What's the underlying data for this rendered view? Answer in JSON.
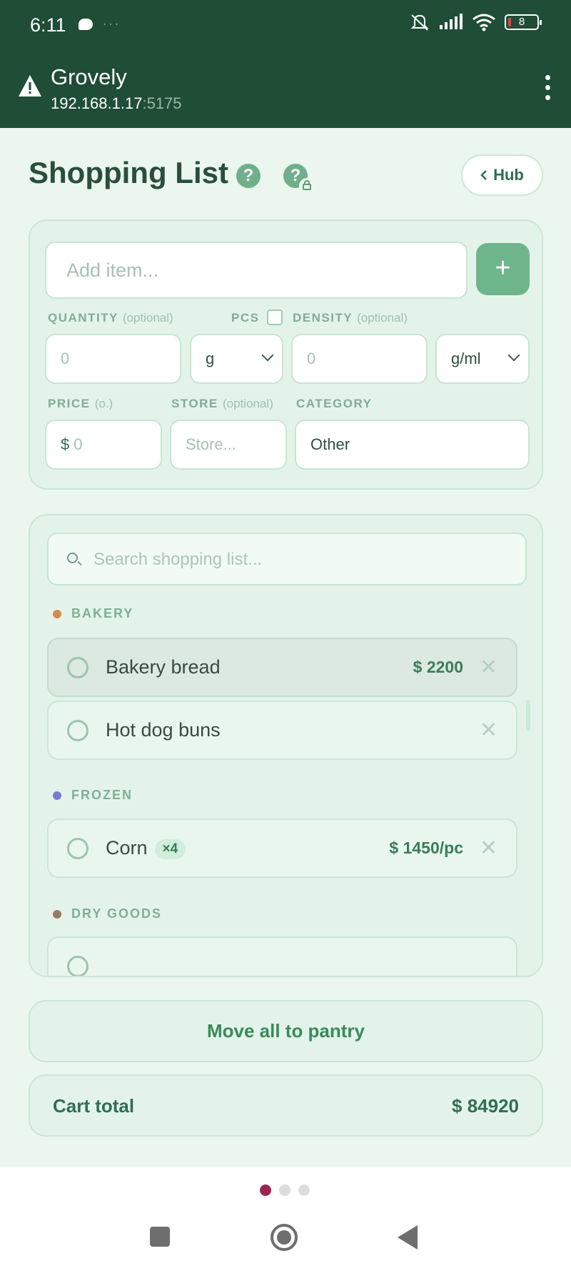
{
  "status_bar": {
    "time": "6:11",
    "dots": "···",
    "battery": "8"
  },
  "app_bar": {
    "title": "Grovely",
    "url_host": "192.168.1.17",
    "url_port": ":5175"
  },
  "header": {
    "title": "Shopping List",
    "help_icon": "?",
    "help_lock_icon": "?",
    "hub_label": "Hub"
  },
  "add_form": {
    "add_item_placeholder": "Add item...",
    "add_button": "+",
    "quantity_label": "QUANTITY",
    "quantity_opt": "(optional)",
    "quantity_placeholder": "0",
    "unit_value": "g",
    "pcs_label": "PCS",
    "density_label": "DENSITY",
    "density_opt": "(optional)",
    "density_placeholder": "0",
    "density_unit_value": "g/ml",
    "price_label": "PRICE",
    "price_opt": "(o.)",
    "price_currency": "$",
    "price_placeholder": "0",
    "store_label": "STORE",
    "store_opt": "(optional)",
    "store_placeholder": "Store...",
    "category_label": "CATEGORY",
    "category_value": "Other"
  },
  "list": {
    "search_placeholder": "Search shopping list...",
    "categories": [
      {
        "name": "BAKERY",
        "color": "#d08a4a"
      },
      {
        "name": "FROZEN",
        "color": "#7b78d0"
      },
      {
        "name": "DRY GOODS",
        "color": "#9a7a62"
      }
    ],
    "items": [
      {
        "name": "Bakery bread",
        "price": "$ 2200",
        "close": "✕"
      },
      {
        "name": "Hot dog buns",
        "close": "✕"
      },
      {
        "name": "Corn",
        "qty": "×4",
        "price": "$ 1450/pc",
        "close": "✕"
      }
    ]
  },
  "actions": {
    "move_all": "Move all to pantry"
  },
  "cart": {
    "label": "Cart total",
    "value": "$ 84920"
  }
}
